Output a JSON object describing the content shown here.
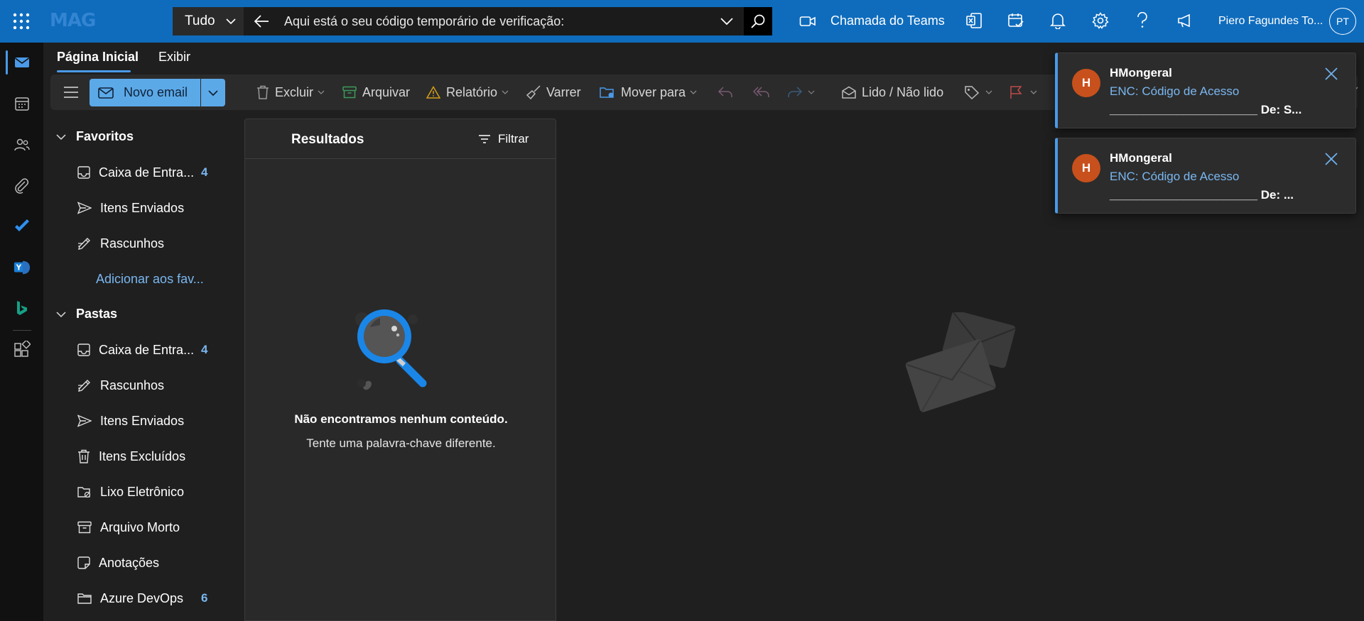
{
  "topbar": {
    "brand": "MAG",
    "search_scope": "Tudo",
    "search_query": "Aqui está o seu código temporário de verificação:",
    "teams_call": "Chamada do Teams",
    "user_name": "Piero Fagundes To...",
    "user_initials": "PT",
    "accent": "#0f6cbd"
  },
  "tabs": {
    "home": "Página Inicial",
    "view": "Exibir"
  },
  "toolbar": {
    "new_mail": "Novo email",
    "delete": "Excluir",
    "archive": "Arquivar",
    "report": "Relatório",
    "sweep": "Varrer",
    "move_to": "Mover para",
    "read_unread": "Lido / Não lido"
  },
  "folders": {
    "favorites_header": "Favoritos",
    "favorites": [
      {
        "label": "Caixa de Entra...",
        "count": "4",
        "icon": "inbox-icon"
      },
      {
        "label": "Itens Enviados",
        "icon": "send-icon"
      },
      {
        "label": "Rascunhos",
        "icon": "draft-icon"
      }
    ],
    "add_favorite": "Adicionar aos fav...",
    "folders_header": "Pastas",
    "items": [
      {
        "label": "Caixa de Entra...",
        "count": "4",
        "icon": "inbox-icon"
      },
      {
        "label": "Rascunhos",
        "icon": "draft-icon"
      },
      {
        "label": "Itens Enviados",
        "icon": "send-icon"
      },
      {
        "label": "Itens Excluídos",
        "icon": "trash-icon"
      },
      {
        "label": "Lixo Eletrônico",
        "icon": "junk-icon"
      },
      {
        "label": "Arquivo Morto",
        "icon": "archive-icon"
      },
      {
        "label": "Anotações",
        "icon": "note-icon"
      },
      {
        "label": "Azure DevOps",
        "count": "6",
        "icon": "folder-icon"
      }
    ]
  },
  "results": {
    "title": "Resultados",
    "filter": "Filtrar",
    "empty_title": "Não encontramos nenhum conteúdo.",
    "empty_subtitle": "Tente uma palavra-chave diferente."
  },
  "notifications": [
    {
      "initial": "H",
      "from": "HMongeral",
      "subject": "ENC: Código de Acesso",
      "preview": "______________________ De: S..."
    },
    {
      "initial": "H",
      "from": "HMongeral",
      "subject": "ENC: Código de Acesso",
      "preview": "______________________ De: ..."
    }
  ]
}
